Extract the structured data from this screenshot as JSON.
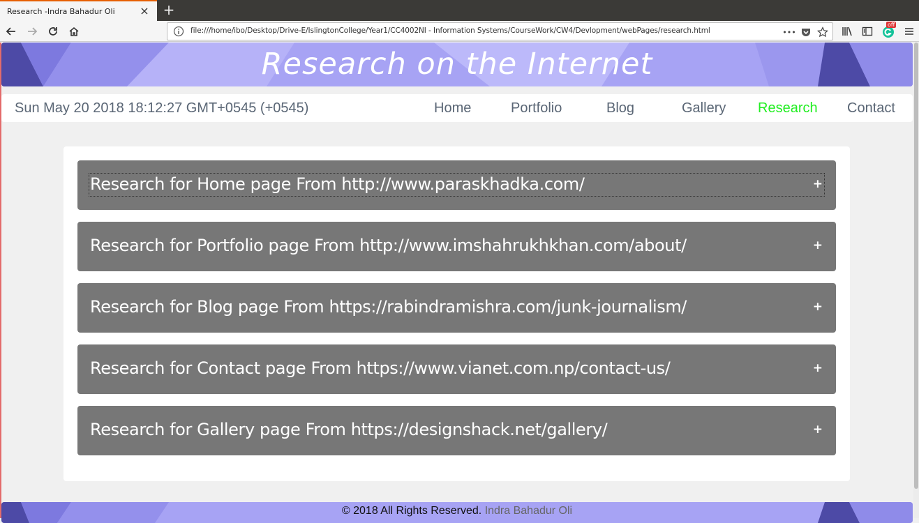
{
  "browser": {
    "tab_title": "Research -Indra Bahadur Oli",
    "tab_close": "×",
    "new_tab": "+",
    "url": "file:///home/ibo/Desktop/Drive-E/IslingtonCollege/Year1/CC4002NI - Information Systems/CourseWork/CW4/Devlopment/webPages/research.html",
    "url_more": "•••",
    "extension_badge": "off"
  },
  "page": {
    "banner_title": "Research on the Internet",
    "datetime": "Sun May 20 2018 18:12:27 GMT+0545 (+0545)",
    "nav": [
      {
        "label": "Home"
      },
      {
        "label": "Portfolio"
      },
      {
        "label": "Blog"
      },
      {
        "label": "Gallery"
      },
      {
        "label": "Research",
        "active": true
      },
      {
        "label": "Contact"
      }
    ],
    "active_color": "#22ee22",
    "accordion": [
      {
        "title": "Research for Home page From http://www.paraskhadka.com/",
        "toggle": "+"
      },
      {
        "title": "Research for Portfolio page From http://www.imshahrukhkhan.com/about/",
        "toggle": "+"
      },
      {
        "title": "Research for Blog page From https://rabindramishra.com/junk-journalism/",
        "toggle": "+"
      },
      {
        "title": "Research for Contact page From https://www.vianet.com.np/contact-us/",
        "toggle": "+"
      },
      {
        "title": "Research for Gallery page From https://designshack.net/gallery/",
        "toggle": "+"
      }
    ],
    "footer": {
      "copyright": "© 2018 All Rights Reserved.",
      "author": "Indra Bahadur Oli"
    }
  }
}
